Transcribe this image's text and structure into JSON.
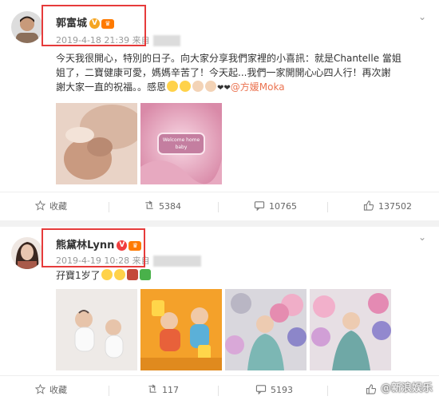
{
  "post1": {
    "author": "郭富城",
    "meta": "2019-4-18 21:39 来自",
    "text_lines": [
      "今天我很開心，特別的日子。向大家分享我們家裡的小喜訊：就是Chantelle 當姐",
      "姐了，二寶健康可愛，媽媽辛苦了！今天起...我們一家開開心心四人行！再次謝",
      "謝大家一直的祝福。。感恩"
    ],
    "mention": "@方媛Moka",
    "card_text": "Welcome home baby",
    "actions": {
      "favorite": "收藏",
      "repost": "5384",
      "comment": "10765",
      "like": "137502"
    }
  },
  "post2": {
    "author": "熊黛林Lynn",
    "meta": "2019-4-19 10:28 来自",
    "text": "孖寶1岁了",
    "actions": {
      "favorite": "收藏",
      "repost": "117",
      "comment": "5193",
      "like": ""
    }
  },
  "watermark": "@新浪娱乐",
  "colors": {
    "highlight_box": "#e63b3b",
    "mention": "#eb7350",
    "vip_badge": "#f5a623"
  }
}
